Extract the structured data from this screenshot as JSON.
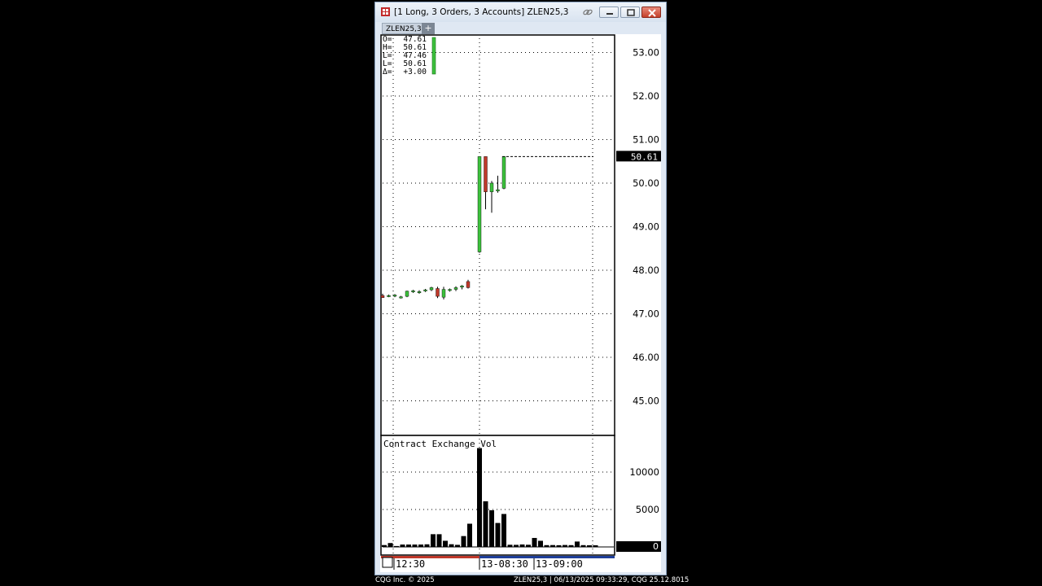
{
  "window": {
    "title": "[1 Long, 3 Orders, 3 Accounts]  ZLEN25,3",
    "tab_label": "ZLEN25,3",
    "add_tab_label": "+"
  },
  "info_box": {
    "rows": [
      {
        "label": "O=",
        "value": "47.61"
      },
      {
        "label": "H=",
        "value": "50.61"
      },
      {
        "label": "L=",
        "value": "47.46"
      },
      {
        "label": "L=",
        "value": "50.61"
      },
      {
        "label": "Δ=",
        "value": "+3.00"
      }
    ]
  },
  "price_axis": {
    "ticks": [
      "53.00",
      "52.00",
      "51.00",
      "50.00",
      "49.00",
      "48.00",
      "47.00",
      "46.00",
      "45.00"
    ],
    "last_price": "50.61"
  },
  "volume_panel": {
    "title": "Contract Exchange Vol",
    "ticks": [
      "10000",
      "5000",
      "0"
    ]
  },
  "time_axis": {
    "labels": [
      "12:30",
      "13-08:30",
      "13-09:00"
    ]
  },
  "status_bar": {
    "left": "CQG Inc. © 2025",
    "right": "ZLEN25,3 | 06/13/2025 09:33:29, CQG 25.12.8015"
  },
  "colors": {
    "up": "#3cc13c",
    "down": "#c0392b",
    "background": "#ffffff",
    "grid": "#000000",
    "session_bar_left": "#c0392b",
    "session_bar_right": "#1f3f9a"
  },
  "chart_data": [
    {
      "type": "candlestick",
      "title": "",
      "price_unit": "",
      "ylim": [
        44.35,
        53.45
      ],
      "grid": true,
      "last_price": 50.61,
      "candles_session1": [
        {
          "o": 47.42,
          "h": 47.46,
          "l": 47.37,
          "c": 47.37
        },
        {
          "o": 47.41,
          "h": 47.44,
          "l": 47.38,
          "c": 47.42
        },
        {
          "o": 47.42,
          "h": 47.45,
          "l": 47.38,
          "c": 47.43
        },
        {
          "o": 47.38,
          "h": 47.41,
          "l": 47.35,
          "c": 47.39
        },
        {
          "o": 47.4,
          "h": 47.53,
          "l": 47.38,
          "c": 47.52
        },
        {
          "o": 47.52,
          "h": 47.55,
          "l": 47.48,
          "c": 47.53
        },
        {
          "o": 47.5,
          "h": 47.54,
          "l": 47.46,
          "c": 47.51
        },
        {
          "o": 47.53,
          "h": 47.57,
          "l": 47.5,
          "c": 47.55
        },
        {
          "o": 47.55,
          "h": 47.62,
          "l": 47.52,
          "c": 47.6
        },
        {
          "o": 47.58,
          "h": 47.62,
          "l": 47.36,
          "c": 47.4
        },
        {
          "o": 47.38,
          "h": 47.62,
          "l": 47.33,
          "c": 47.56
        },
        {
          "o": 47.55,
          "h": 47.58,
          "l": 47.51,
          "c": 47.56
        },
        {
          "o": 47.56,
          "h": 47.63,
          "l": 47.52,
          "c": 47.6
        },
        {
          "o": 47.61,
          "h": 47.66,
          "l": 47.56,
          "c": 47.64
        },
        {
          "o": 47.74,
          "h": 47.78,
          "l": 47.58,
          "c": 47.6
        }
      ],
      "candles_session2": [
        {
          "o": 48.42,
          "h": 50.61,
          "l": 48.4,
          "c": 50.61
        },
        {
          "o": 50.61,
          "h": 50.61,
          "l": 49.4,
          "c": 49.8
        },
        {
          "o": 49.8,
          "h": 50.05,
          "l": 49.32,
          "c": 50.0
        },
        {
          "o": 49.82,
          "h": 50.17,
          "l": 49.78,
          "c": 49.85
        },
        {
          "o": 49.88,
          "h": 50.61,
          "l": 49.86,
          "c": 50.61
        }
      ],
      "volume": {
        "ylim": [
          0,
          13000
        ],
        "session1": [
          250,
          520,
          120,
          320,
          320,
          320,
          320,
          350,
          1700,
          1700,
          820,
          360,
          280,
          1450,
          3100
        ],
        "session2": [
          13200,
          6100,
          4900,
          3200,
          4400,
          290,
          280,
          330,
          290,
          1200,
          820,
          240,
          250,
          230,
          260,
          240,
          720,
          240,
          220,
          220
        ]
      },
      "x_labels": [
        "12:30",
        "13-08:30",
        "13-09:00"
      ]
    }
  ]
}
